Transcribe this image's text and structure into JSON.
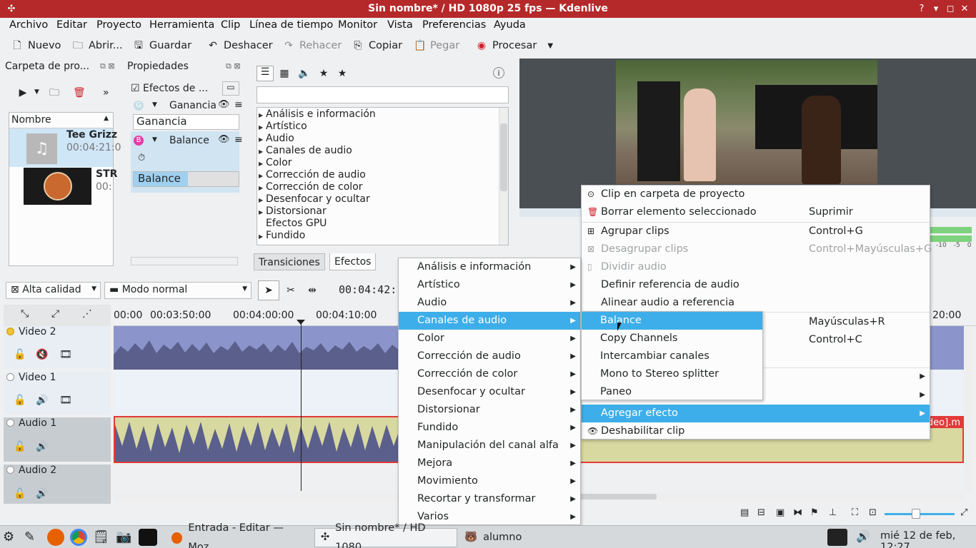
{
  "window": {
    "title": "Sin nombre* / HD 1080p 25 fps — Kdenlive"
  },
  "menubar": [
    "Archivo",
    "Editar",
    "Proyecto",
    "Herramienta",
    "Clip",
    "Línea de tiempo",
    "Monitor",
    "Vista",
    "Preferencias",
    "Ayuda"
  ],
  "toolbar": {
    "new": "Nuevo",
    "open": "Abrir...",
    "save": "Guardar",
    "undo": "Deshacer",
    "redo": "Rehacer",
    "copy": "Copiar",
    "paste": "Pegar",
    "render": "Procesar"
  },
  "project_bin": {
    "title": "Carpeta de pro...",
    "column": "Nombre",
    "clips": [
      {
        "name": "Tee Grizz",
        "duration": "00:04:21:0"
      },
      {
        "name": "STR",
        "duration": "00:"
      }
    ]
  },
  "properties": {
    "title": "Propiedades",
    "effects_label": "Efectos de ...",
    "effect1": "Ganancia",
    "effect1_param": "Ganancia",
    "effect2": "Balance",
    "effect2_param": "Balance"
  },
  "effects": {
    "search_placeholder": "",
    "categories": [
      "Análisis e información",
      "Artístico",
      "Audio",
      "Canales de audio",
      "Color",
      "Corrección de audio",
      "Corrección de color",
      "Desenfocar y ocultar",
      "Distorsionar",
      "Efectos GPU",
      "Fundido",
      "Manipulación del canal alfa"
    ],
    "tab_transitions": "Transiciones",
    "tab_effects": "Efectos"
  },
  "timeline": {
    "quality": "Alta calidad",
    "mode": "Modo normal",
    "timecode": "00:04:42:",
    "ruler": [
      "00:00",
      "00:03:50:00",
      "00:04:00:00",
      "00:04:10:00",
      "20:00"
    ],
    "tracks": [
      "Video 2",
      "Video 1",
      "Audio 1",
      "Audio 2"
    ],
    "clip_label": "ideo].m"
  },
  "context_menu": {
    "items": [
      {
        "label": "Clip en carpeta de proyecto",
        "shortcut": ""
      },
      {
        "label": "Borrar elemento seleccionado",
        "shortcut": "Suprimir"
      },
      {
        "label": "Agrupar clips",
        "shortcut": "Control+G"
      },
      {
        "label": "Desagrupar clips",
        "shortcut": "Control+Mayúsculas+G"
      },
      {
        "label": "Dividir audio",
        "shortcut": ""
      },
      {
        "label": "Definir referencia de audio",
        "shortcut": ""
      },
      {
        "label": "Alinear audio a referencia",
        "shortcut": ""
      },
      {
        "label": "",
        "shortcut": "Mayúsculas+R"
      },
      {
        "label": "",
        "shortcut": "Control+C"
      },
      {
        "label": "Agregar efecto",
        "shortcut": ""
      },
      {
        "label": "Deshabilitar clip",
        "shortcut": ""
      }
    ]
  },
  "effect_submenu": [
    "Análisis e información",
    "Artístico",
    "Audio",
    "Canales de audio",
    "Color",
    "Corrección de audio",
    "Corrección de color",
    "Desenfocar y ocultar",
    "Distorsionar",
    "Fundido",
    "Manipulación del canal alfa",
    "Mejora",
    "Movimiento",
    "Recortar y transformar",
    "Varios"
  ],
  "channels_submenu": [
    "Balance",
    "Copy Channels",
    "Intercambiar canales",
    "Mono to Stereo splitter",
    "Paneo"
  ],
  "audio_meter": [
    "-10",
    "-5",
    "0"
  ],
  "taskbar": {
    "task1": "Entrada - Editar — Moz...",
    "task2": "Sin nombre* / HD 1080...",
    "task3": "alumno",
    "clock": "mié 12 de feb, 12:27"
  },
  "colors": {
    "accent": "#3daee9",
    "titlebar": "#b5292a",
    "video_clip": "#8b95cc",
    "audio_clip": "#d8d9a0",
    "waveform": "#5b5f8c"
  }
}
